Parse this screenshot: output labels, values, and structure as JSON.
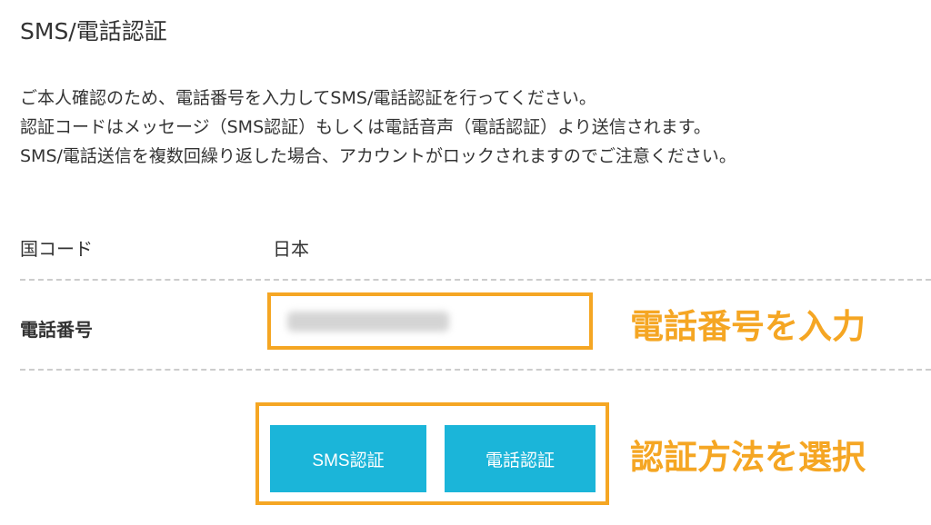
{
  "page": {
    "title": "SMS/電話認証",
    "intro_lines": [
      "ご本人確認のため、電話番号を入力してSMS/電話認証を行ってください。",
      "認証コードはメッセージ（SMS認証）もしくは電話音声（電話認証）より送信されます。",
      "SMS/電話送信を複数回繰り返した場合、アカウントがロックされますのでご注意ください。"
    ]
  },
  "form": {
    "country": {
      "label": "国コード",
      "value": "日本"
    },
    "phone": {
      "label": "電話番号",
      "value": ""
    },
    "buttons": {
      "sms_label": "SMS認証",
      "phone_label": "電話認証"
    }
  },
  "annotations": {
    "phone": "電話番号を入力",
    "method": "認証方法を選択"
  },
  "colors": {
    "accent_button": "#1bb5d9",
    "annotation": "#f5a623",
    "text": "#333333"
  }
}
